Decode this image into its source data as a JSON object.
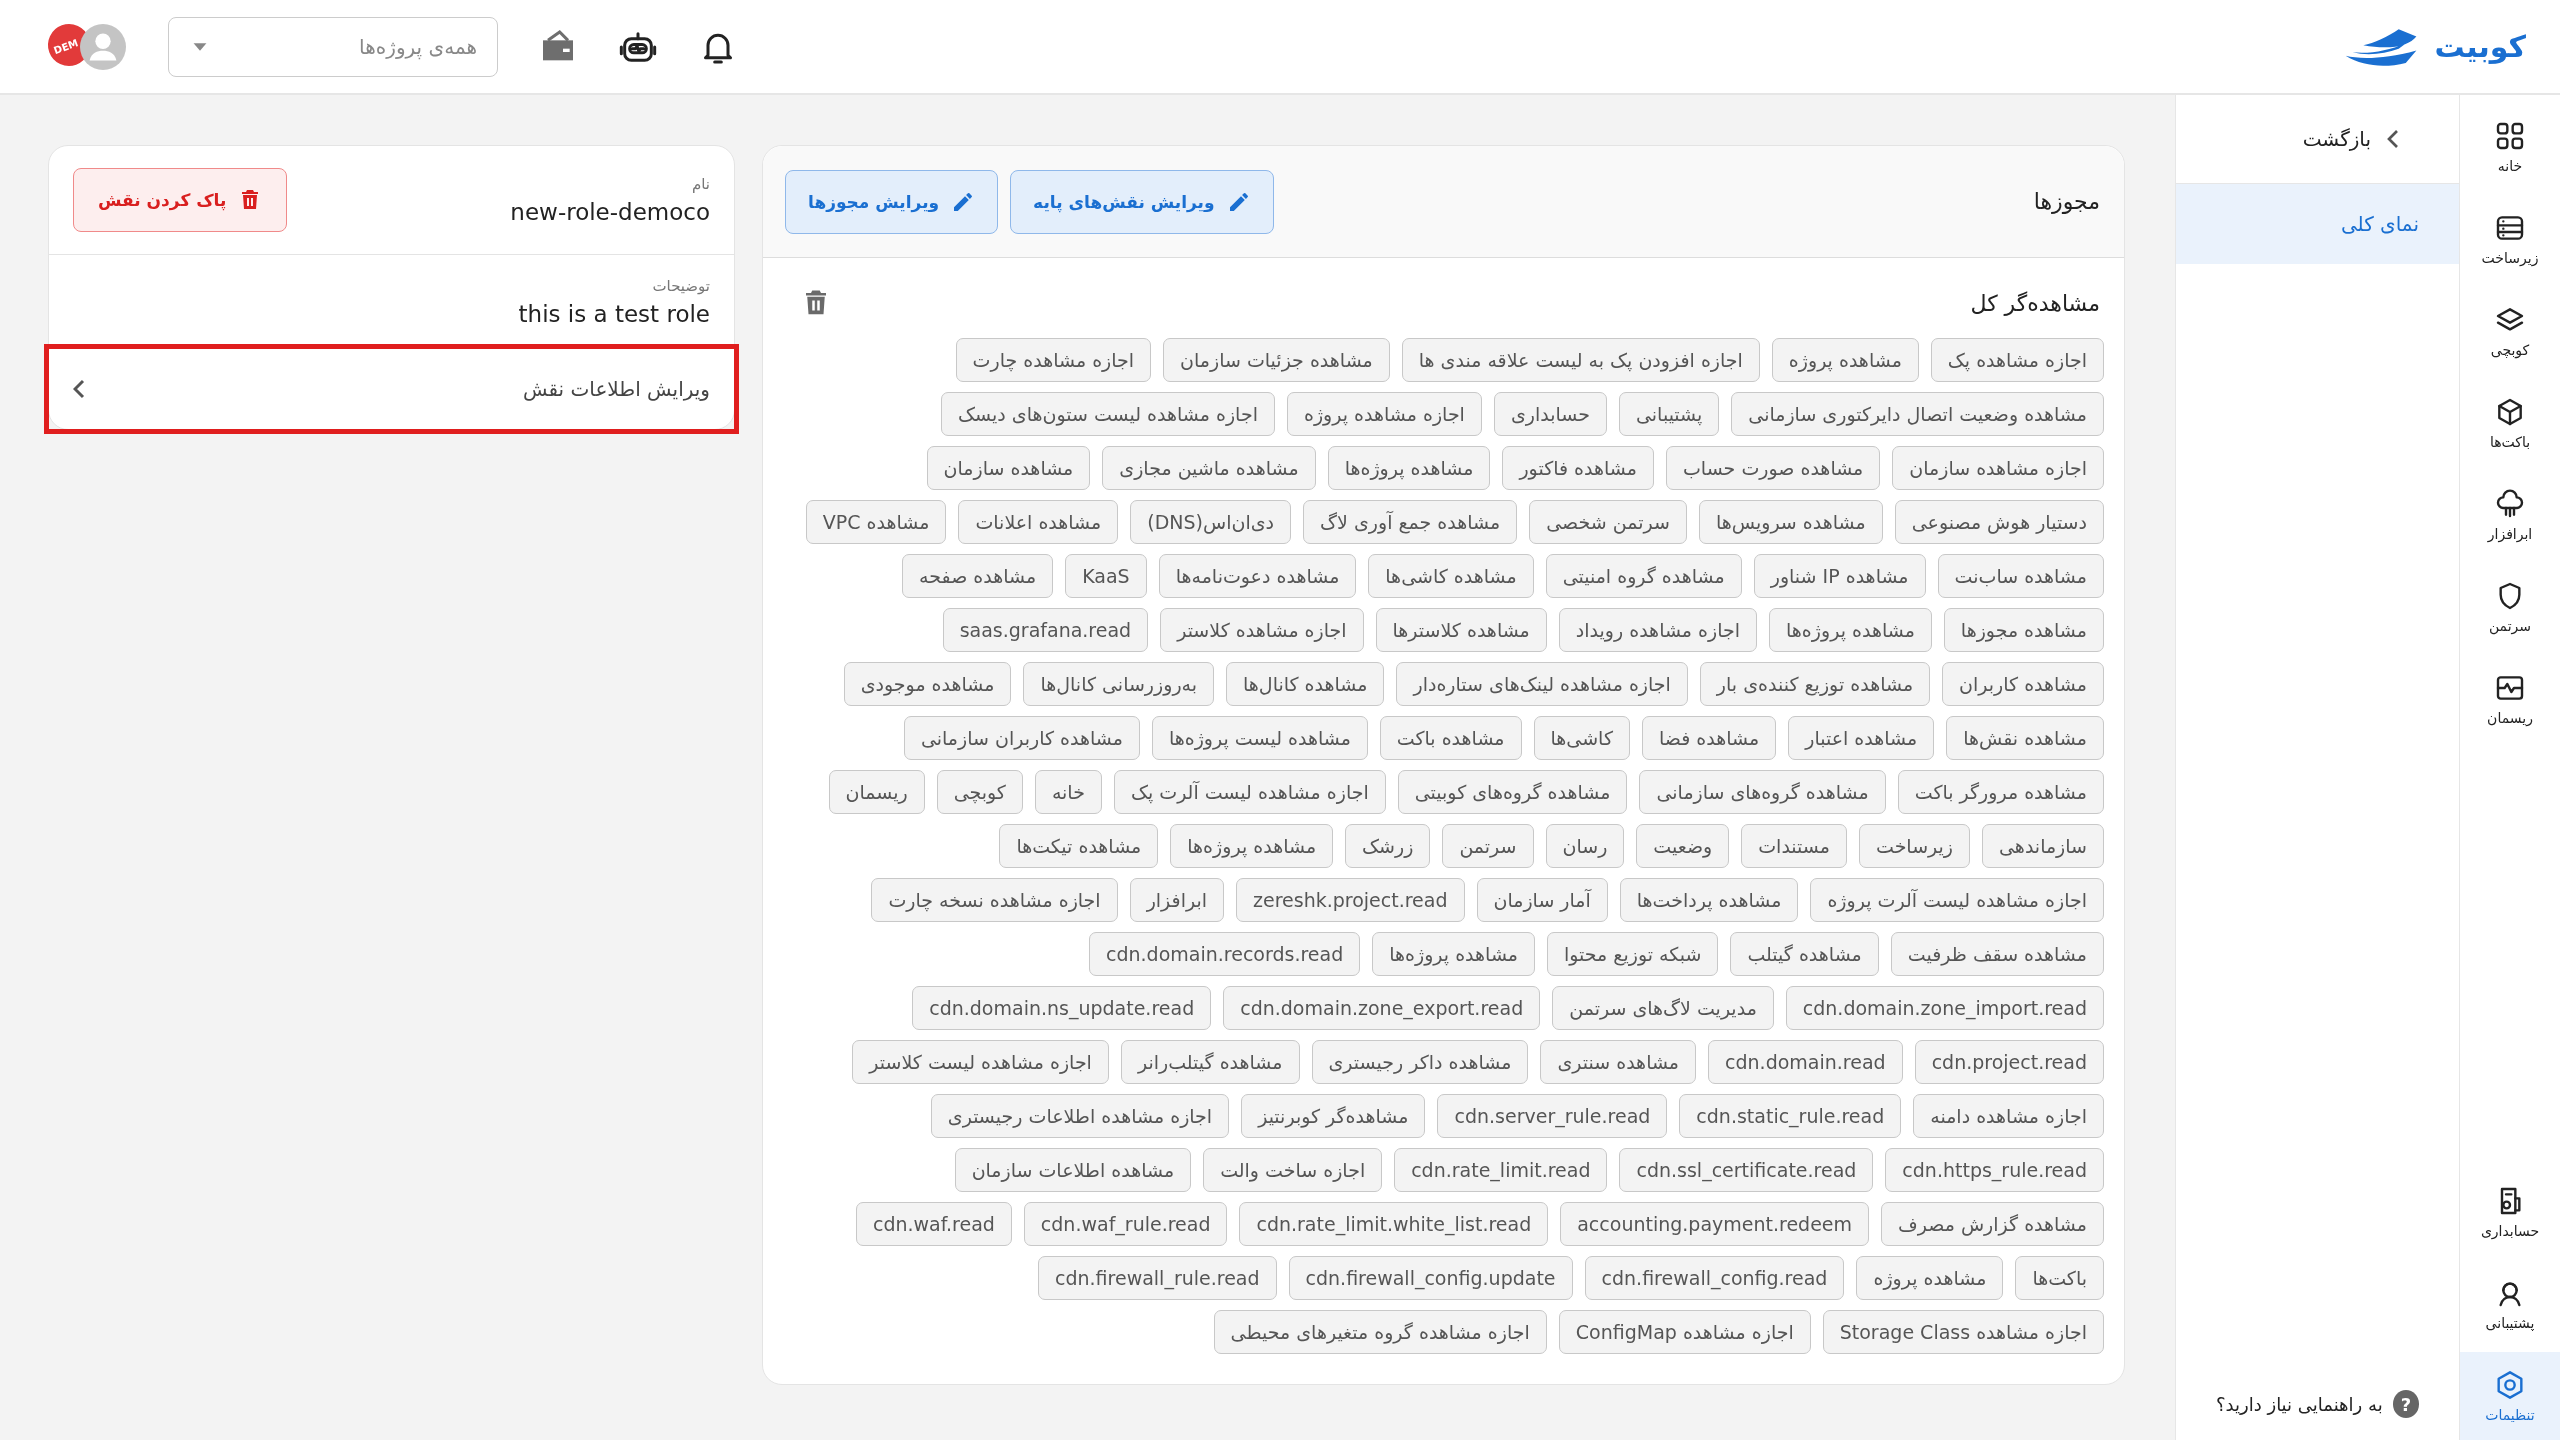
{
  "header": {
    "logo": "کوبیت",
    "project_select": {
      "placeholder": "همه‌ی پروژه‌ها"
    },
    "stamp": "DEM"
  },
  "nav_rail": {
    "top_items": [
      {
        "label": "خانه",
        "selected": false
      },
      {
        "label": "زیرساخت",
        "selected": false
      },
      {
        "label": "کوبچی",
        "selected": false
      },
      {
        "label": "باکت‌ها",
        "selected": false
      },
      {
        "label": "ابرافزار",
        "selected": false
      },
      {
        "label": "سرتمن",
        "selected": false
      },
      {
        "label": "ریسمان",
        "selected": false
      }
    ],
    "bottom_items": [
      {
        "label": "حسابداری",
        "selected": false
      },
      {
        "label": "پشتیبانی",
        "selected": false
      },
      {
        "label": "تنظیمات",
        "selected": true
      }
    ]
  },
  "submenu": {
    "back": "بازگشت",
    "items": [
      {
        "label": "نمای کلی",
        "selected": true
      }
    ],
    "help": "به راهنمایی نیاز دارید؟",
    "help_icon": "?"
  },
  "role_card": {
    "name_label": "نام",
    "name": "new-role-democo",
    "delete_button": "پاک کردن نقش",
    "description_label": "توضیحات",
    "description": "this is a test role",
    "edit_row": {
      "label": "ویرایش اطلاعات نقش",
      "highlighted": true
    }
  },
  "permissions": {
    "title": "مجوزها",
    "buttons": [
      "ویرایش نقش‌های پایه",
      "ویرایش مجوزها"
    ],
    "group": {
      "title": "مشاهده‌گر کل",
      "chips": [
        "اجازه مشاهده پک",
        "مشاهده پروژه",
        "اجازه افزودن پک به لیست علاقه مندی ها",
        "مشاهده جزئیات سازمان",
        "اجازه مشاهده چارت",
        "مشاهده وضعیت اتصال دایرکتوری سازمانی",
        "پشتیبانی",
        "حسابداری",
        "اجازه مشاهده پروژه",
        "اجازه مشاهده لیست ستون‌های دیسک",
        "اجازه مشاهده سازمان",
        "مشاهده صورت حساب",
        "مشاهده فاکتور",
        "مشاهده پروژه‌ها",
        "مشاهده ماشین مجازی",
        "مشاهده سازمان",
        "دستیار هوش مصنوعی",
        "مشاهده سرویس‌ها",
        "سرتمن شخصی",
        "مشاهده جمع آوری لاگ",
        "دی‌ان‌اس(DNS)",
        "مشاهده اعلانات",
        "مشاهده VPC",
        "مشاهده ساب‌نت",
        "مشاهده IP شناور",
        "مشاهده گروه امنیتی",
        "مشاهده کاشی‌ها",
        "مشاهده دعوت‌نامه‌ها",
        "KaaS",
        "مشاهده صفحه",
        "مشاهده مجوزها",
        "مشاهده پروژه‌ها",
        "اجازه مشاهده رویداد",
        "مشاهده کلاسترها",
        "اجازه مشاهده کلاستر",
        "saas.grafana.read",
        "مشاهده کاربران",
        "مشاهده توزیع کننده‌ی بار",
        "اجازه مشاهده لینک‌های ستاره‌دار",
        "مشاهده کانال‌ها",
        "به‌روزرسانی کانال‌ها",
        "مشاهده موجودی",
        "مشاهده نقش‌ها",
        "مشاهده اعتبار",
        "مشاهده فضا",
        "کاشی‌ها",
        "مشاهده باکت",
        "مشاهده لیست پروژه‌ها",
        "مشاهده کاربران سازمانی",
        "مشاهده مرورگر باکت",
        "مشاهده گروه‌های سازمانی",
        "مشاهده گروه‌های کوبیتی",
        "اجازه مشاهده لیست آلرت پک",
        "خانه",
        "کوبچی",
        "ریسمان",
        "سازماندهی",
        "زیرساخت",
        "مستندات",
        "وضعیت",
        "رسان",
        "سرتمن",
        "زرشک",
        "مشاهده پروژه‌ها",
        "مشاهده تیکت‌ها",
        "اجازه مشاهده لیست آلرت پروژه",
        "مشاهده پرداخت‌ها",
        "آمار سازمان",
        "zereshk.project.read",
        "ابرافزار",
        "اجازه مشاهده نسخه چارت",
        "مشاهده سقف ظرفیت",
        "مشاهده گیتلب",
        "شبکه توزیع محتوا",
        "مشاهده پروژه‌ها",
        "cdn.domain.records.read",
        "cdn.domain.zone_import.read",
        "مدیریت لاگ‌های سرتمن",
        "cdn.domain.zone_export.read",
        "cdn.domain.ns_update.read",
        "cdn.project.read",
        "cdn.domain.read",
        "مشاهده سنتری",
        "مشاهده داکر رجیستری",
        "مشاهده گیتلب‌رانر",
        "اجازه مشاهده لیست کلاستر",
        "اجازه مشاهده دامنه",
        "cdn.static_rule.read",
        "cdn.server_rule.read",
        "مشاهده‌گر کوبرنتیز",
        "اجازه مشاهده اطلاعات رجیستری",
        "cdn.https_rule.read",
        "cdn.ssl_certificate.read",
        "cdn.rate_limit.read",
        "اجازه ساخت والت",
        "مشاهده اطلاعات سازمان",
        "مشاهده گزارش مصرف",
        "accounting.payment.redeem",
        "cdn.rate_limit.white_list.read",
        "cdn.waf_rule.read",
        "cdn.waf.read",
        "باکت‌ها",
        "مشاهده پروژه",
        "cdn.firewall_config.read",
        "cdn.firewall_config.update",
        "cdn.firewall_rule.read",
        "اجازه مشاهده Storage Class",
        "اجازه مشاهده ConfigMap",
        "اجازه مشاهده گروه متغیرهای محیطی"
      ]
    }
  }
}
